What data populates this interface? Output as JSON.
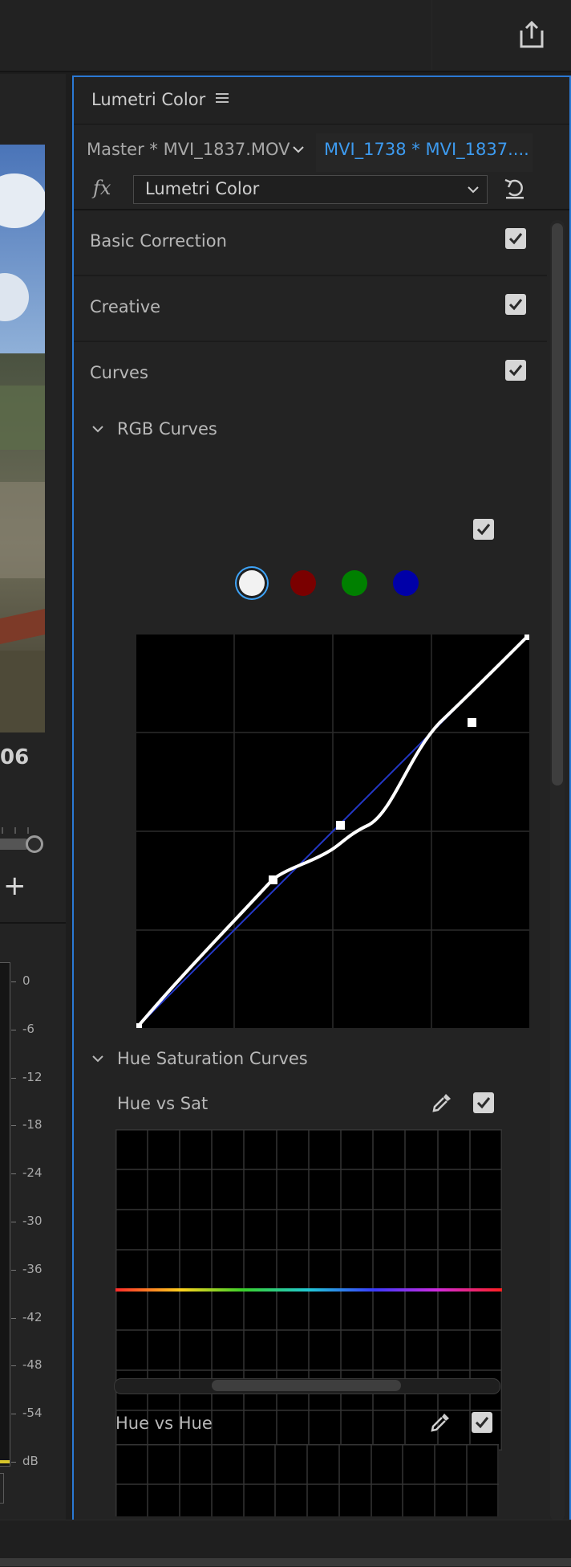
{
  "window": {
    "share_icon": "share-export-icon"
  },
  "monitor": {
    "timecode_fragment": "06",
    "add_button_label": "+",
    "audio_meter": {
      "scale": [
        "0",
        "-6",
        "-12",
        "-18",
        "-24",
        "-30",
        "-36",
        "-42",
        "-48",
        "-54",
        "dB"
      ]
    }
  },
  "panel": {
    "title": "Lumetri Color",
    "menu_icon": "hamburger-menu-icon",
    "master_clip_label": "Master * MVI_1837.MOV",
    "sequence_clip_label": "MVI_1738 * MVI_1837....",
    "fx_label": "fx",
    "effect_select_value": "Lumetri Color",
    "reset_icon": "reset-icon",
    "sections": [
      {
        "label": "Basic Correction",
        "enabled": true
      },
      {
        "label": "Creative",
        "enabled": true
      },
      {
        "label": "Curves",
        "enabled": true
      }
    ],
    "rgb_curves": {
      "label": "RGB Curves",
      "enabled": true,
      "channels": [
        {
          "name": "luma",
          "color": "#f2f2f2",
          "selected": true
        },
        {
          "name": "red",
          "color": "#7a0000",
          "selected": false
        },
        {
          "name": "green",
          "color": "#008000",
          "selected": false
        },
        {
          "name": "blue",
          "color": "#0000a8",
          "selected": false
        }
      ]
    },
    "hue_sat_curves": {
      "label": "Hue Saturation Curves",
      "graphs": [
        {
          "label": "Hue vs Sat",
          "enabled": true
        },
        {
          "label": "Hue vs Hue",
          "enabled": true
        }
      ]
    }
  },
  "colors": {
    "accent": "#2b79d4",
    "link": "#3d9bf0"
  }
}
